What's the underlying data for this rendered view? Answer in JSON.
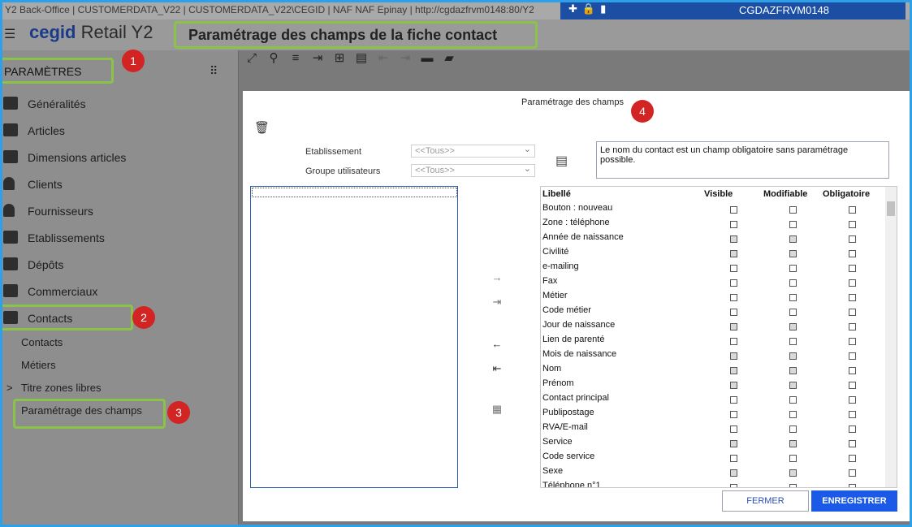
{
  "sysbar": {
    "path": "Y2 Back-Office  |  CUSTOMERDATA_V22  |  CUSTOMERDATA_V22\\CEGID  |  NAF NAF Epinay  |  http://cgdazfrvm0148:80/Y2",
    "host": "CGDAZFRVM0148"
  },
  "app": {
    "brand": "cegid",
    "product": " Retail Y2",
    "title": "Paramétrage des champs de la fiche contact"
  },
  "sidebar": {
    "header": "PARAMÈTRES",
    "items": [
      {
        "label": "Généralités"
      },
      {
        "label": "Articles"
      },
      {
        "label": "Dimensions articles"
      },
      {
        "label": "Clients"
      },
      {
        "label": "Fournisseurs"
      },
      {
        "label": "Etablissements"
      },
      {
        "label": "Dépôts"
      },
      {
        "label": "Commerciaux"
      },
      {
        "label": "Contacts"
      }
    ],
    "subitems": [
      {
        "label": "Contacts"
      },
      {
        "label": "Métiers"
      },
      {
        "label": "Titre zones libres",
        "prefix": ">"
      },
      {
        "label": "Paramétrage des champs"
      }
    ]
  },
  "badges": [
    "1",
    "2",
    "3",
    "4"
  ],
  "dialog": {
    "title": "Paramétrage des champs",
    "etablissement_label": "Etablissement",
    "etablissement_value": "<<Tous>>",
    "groupe_label": "Groupe utilisateurs",
    "groupe_value": "<<Tous>>",
    "info": "Le nom du contact est un champ obligatoire sans paramétrage possible.",
    "columns": [
      "Libellé",
      "Visible",
      "Modifiable",
      "Obligatoire"
    ],
    "rows": [
      {
        "name": "Bouton : nouveau",
        "visible": false,
        "modifiable": false,
        "obligatoire": false
      },
      {
        "name": "Zone : téléphone",
        "visible": false,
        "modifiable": false,
        "obligatoire": false
      },
      {
        "name": "Année de naissance",
        "visible": true,
        "modifiable": true,
        "obligatoire": false
      },
      {
        "name": "Civilité",
        "visible": true,
        "modifiable": true,
        "obligatoire": false
      },
      {
        "name": "e-mailing",
        "visible": false,
        "modifiable": false,
        "obligatoire": false
      },
      {
        "name": "Fax",
        "visible": false,
        "modifiable": false,
        "obligatoire": false
      },
      {
        "name": "Métier",
        "visible": false,
        "modifiable": false,
        "obligatoire": false
      },
      {
        "name": "Code métier",
        "visible": false,
        "modifiable": false,
        "obligatoire": false
      },
      {
        "name": "Jour de naissance",
        "visible": true,
        "modifiable": true,
        "obligatoire": false
      },
      {
        "name": "Lien de parenté",
        "visible": false,
        "modifiable": false,
        "obligatoire": false
      },
      {
        "name": "Mois de naissance",
        "visible": true,
        "modifiable": true,
        "obligatoire": false
      },
      {
        "name": "Nom",
        "visible": true,
        "modifiable": true,
        "obligatoire": false
      },
      {
        "name": "Prénom",
        "visible": true,
        "modifiable": true,
        "obligatoire": false
      },
      {
        "name": "Contact principal",
        "visible": false,
        "modifiable": false,
        "obligatoire": false
      },
      {
        "name": "Publipostage",
        "visible": false,
        "modifiable": false,
        "obligatoire": false
      },
      {
        "name": "RVA/E-mail",
        "visible": false,
        "modifiable": false,
        "obligatoire": false
      },
      {
        "name": "Service",
        "visible": true,
        "modifiable": true,
        "obligatoire": false
      },
      {
        "name": "Code service",
        "visible": false,
        "modifiable": false,
        "obligatoire": false
      },
      {
        "name": "Sexe",
        "visible": true,
        "modifiable": true,
        "obligatoire": false
      },
      {
        "name": "Téléphone n°1",
        "visible": false,
        "modifiable": false,
        "obligatoire": false
      }
    ],
    "close_label": "FERMER",
    "save_label": "ENREGISTRER"
  }
}
